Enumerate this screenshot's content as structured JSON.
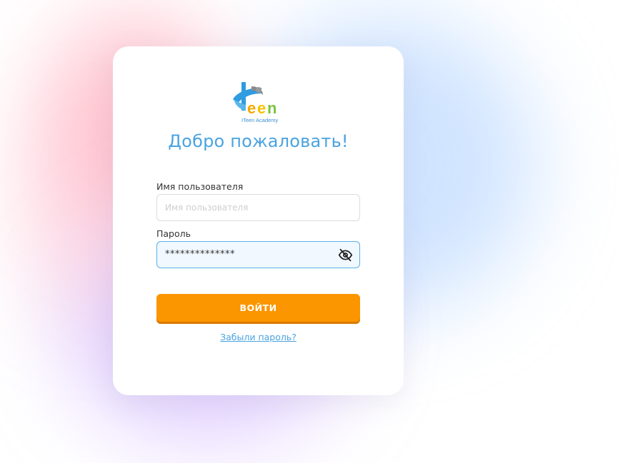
{
  "logo": {
    "wordmark": "Teen",
    "caption": "ITeen Academy"
  },
  "login": {
    "title": "Добро пожаловать!",
    "username_label": "Имя пользователя",
    "username_placeholder": "Имя пользователя",
    "password_label": "Пароль",
    "password_value": "**************",
    "submit_label": "ВОЙТИ",
    "forgot_password": "Забыли пароль?"
  },
  "icons": {
    "password_toggle": "eye-off-icon"
  },
  "colors": {
    "accent": "#4aa3e0",
    "button": "#fb9500",
    "field_active_border": "#5ab0ea"
  }
}
